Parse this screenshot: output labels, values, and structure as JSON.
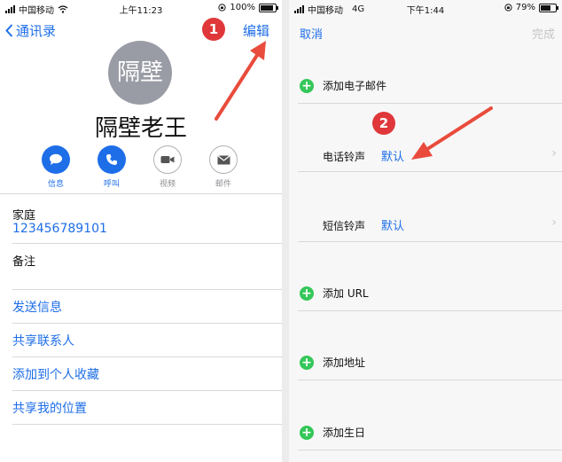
{
  "left": {
    "status": {
      "carrier": "中国移动",
      "time": "上午11:23",
      "battery": "100%",
      "battery_level": 1.0
    },
    "nav": {
      "back_label": "通讯录",
      "edit_label": "编辑"
    },
    "badge": "1",
    "avatar_text": "隔壁",
    "contact_name": "隔壁老王",
    "actions": [
      {
        "label": "信息",
        "icon": "message-icon"
      },
      {
        "label": "呼叫",
        "icon": "phone-icon"
      },
      {
        "label": "视频",
        "icon": "video-icon"
      },
      {
        "label": "邮件",
        "icon": "mail-icon"
      }
    ],
    "field": {
      "label": "家庭",
      "value": "123456789101"
    },
    "notes_label": "备注",
    "links": [
      "发送信息",
      "共享联系人",
      "添加到个人收藏",
      "共享我的位置"
    ]
  },
  "right": {
    "status": {
      "carrier": "中国移动",
      "network": "4G",
      "time": "下午1:44",
      "battery": "79%",
      "battery_level": 0.79
    },
    "nav": {
      "cancel_label": "取消",
      "done_label": "完成"
    },
    "badge": "2",
    "add_email": "添加电子邮件",
    "ringtone": {
      "label": "电话铃声",
      "value": "默认"
    },
    "texttone": {
      "label": "短信铃声",
      "value": "默认"
    },
    "add_url": "添加 URL",
    "add_address": "添加地址",
    "add_birthday": "添加生日"
  },
  "colors": {
    "accent": "#1e6ee8",
    "badge": "#e0383a",
    "plus": "#34c759",
    "arrow": "#e94b3c"
  }
}
